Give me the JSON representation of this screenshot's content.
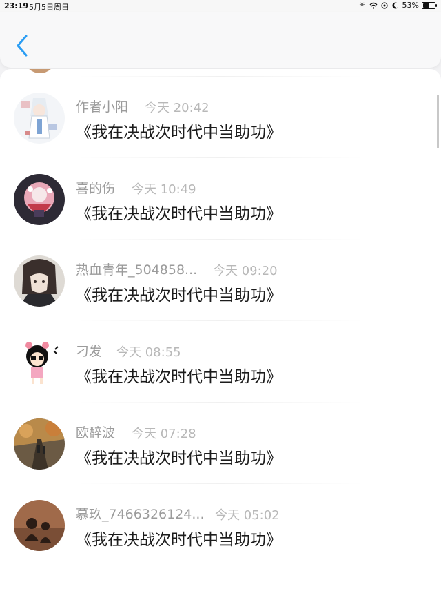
{
  "status_bar": {
    "time": "23:19",
    "date": "5月5日周日",
    "battery": "53%",
    "battery_level": 0.53
  },
  "nav": {
    "back_icon": "chevron-left-icon",
    "accent_color": "#2a9df4"
  },
  "comments": [
    {
      "user": "作者小阳",
      "time": "今天 20:42",
      "text": "《我在决战次时代中当助功》",
      "avatar": "anime-girl-avatar"
    },
    {
      "user": "喜的伤",
      "time": "今天 10:49",
      "text": "《我在决战次时代中当助功》",
      "avatar": "anime-character-avatar"
    },
    {
      "user": "热血青年_504858...",
      "time": "今天 09:20",
      "text": "《我在决战次时代中当助功》",
      "avatar": "anime-boy-avatar"
    },
    {
      "user": "刁发",
      "time": "今天 08:55",
      "text": "《我在决战次时代中当助功》",
      "avatar": "cartoon-girl-avatar"
    },
    {
      "user": "欧醉波",
      "time": "今天 07:28",
      "text": "《我在决战次时代中当助功》",
      "avatar": "autumn-road-avatar"
    },
    {
      "user": "慕玖_7466326124...",
      "time": "今天 05:02",
      "text": "《我在决战次时代中当助功》",
      "avatar": "silhouette-avatar"
    }
  ]
}
